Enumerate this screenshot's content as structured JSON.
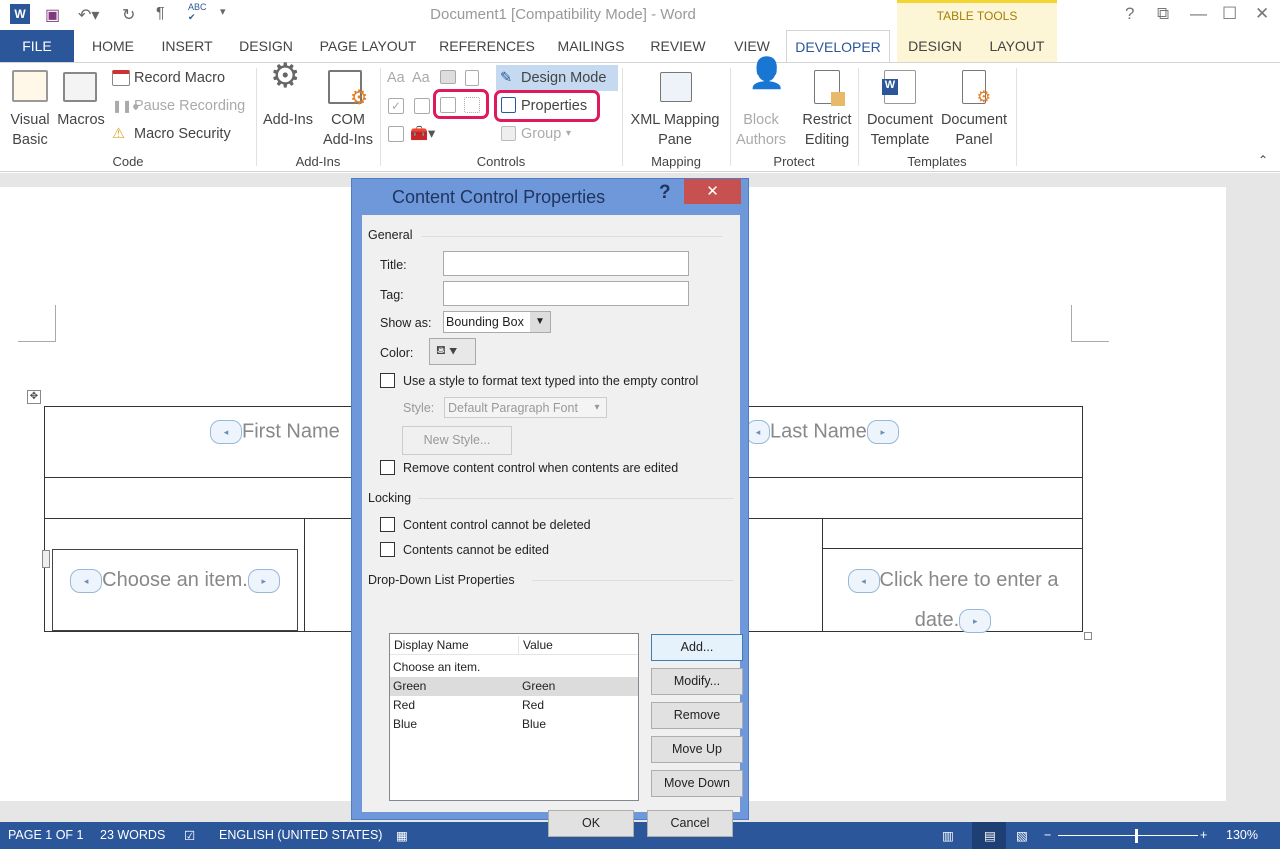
{
  "window": {
    "title": "Document1 [Compatibility Mode] - Word",
    "contextual_group": "TABLE TOOLS",
    "help": "?",
    "restore": "⧉",
    "minimize": "—",
    "maximize": "☐",
    "close": "✕"
  },
  "quick_access": [
    "word-logo",
    "save",
    "undo",
    "redo",
    "show-formatting",
    "spelling",
    "customize"
  ],
  "tabs": [
    "FILE",
    "HOME",
    "INSERT",
    "DESIGN",
    "PAGE LAYOUT",
    "REFERENCES",
    "MAILINGS",
    "REVIEW",
    "VIEW",
    "DEVELOPER",
    "DESIGN",
    "LAYOUT"
  ],
  "active_tab": "DEVELOPER",
  "ribbon": {
    "code": {
      "label": "Code",
      "visual_basic": "Visual Basic",
      "macros": "Macros",
      "record_macro": "Record Macro",
      "pause_recording": "Pause Recording",
      "macro_security": "Macro Security"
    },
    "addins": {
      "label": "Add-Ins",
      "addins": "Add-Ins",
      "com_addins": "COM Add-Ins"
    },
    "controls": {
      "label": "Controls",
      "design_mode": "Design Mode",
      "properties": "Properties",
      "group": "Group"
    },
    "mapping": {
      "label": "Mapping",
      "xml_mapping_pane": "XML Mapping Pane"
    },
    "protect": {
      "label": "Protect",
      "block_authors": "Block Authors",
      "restrict_editing": "Restrict Editing"
    },
    "templates": {
      "label": "Templates",
      "document_template": "Document Template",
      "document_panel": "Document Panel"
    },
    "highlight_color": "#e0195d"
  },
  "document": {
    "first_name": "First Name",
    "last_name": "Last Name",
    "choose_item": "Choose an item.",
    "date_placeholder": "Click here to enter a date."
  },
  "dialog": {
    "title": "Content Control Properties",
    "general": "General",
    "title_label": "Title:",
    "title_value": "",
    "tag_label": "Tag:",
    "tag_value": "",
    "show_as_label": "Show as:",
    "show_as_value": "Bounding Box",
    "color_label": "Color:",
    "use_style": "Use a style to format text typed into the empty control",
    "style_label": "Style:",
    "style_value": "Default Paragraph Font",
    "new_style": "New Style...",
    "remove_cc": "Remove content control when contents are edited",
    "locking": "Locking",
    "cannot_delete": "Content control cannot be deleted",
    "cannot_edit": "Contents cannot be edited",
    "dropdown_props": "Drop-Down List Properties",
    "columns": [
      "Display Name",
      "Value"
    ],
    "rows": [
      [
        "Choose an item.",
        ""
      ],
      [
        "Green",
        "Green"
      ],
      [
        "Red",
        "Red"
      ],
      [
        "Blue",
        "Blue"
      ]
    ],
    "selected_row": 1,
    "buttons": {
      "add": "Add...",
      "modify": "Modify...",
      "remove": "Remove",
      "move_up": "Move Up",
      "move_down": "Move Down",
      "ok": "OK",
      "cancel": "Cancel"
    }
  },
  "status": {
    "page": "PAGE 1 OF 1",
    "words": "23 WORDS",
    "language": "ENGLISH (UNITED STATES)",
    "zoom": "130%",
    "zoom_percent": 130
  }
}
